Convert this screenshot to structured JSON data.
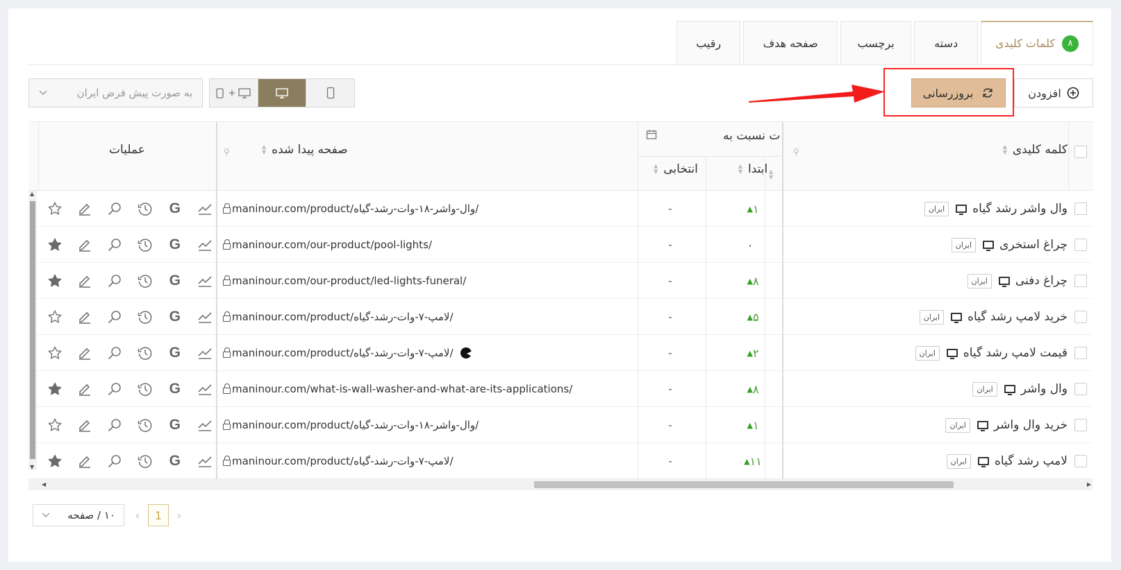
{
  "tabs": [
    {
      "label": "کلمات کلیدی",
      "badge": "۸"
    },
    {
      "label": "دسته"
    },
    {
      "label": "برچسب"
    },
    {
      "label": "صفحه هدف"
    },
    {
      "label": "رقیب"
    }
  ],
  "toolbar": {
    "add_label": "افزودن",
    "refresh_label": "بروزرسانی",
    "device_options": [
      "desktop+mobile",
      "desktop",
      "mobile"
    ],
    "selected_device": "desktop",
    "region_placeholder": "به صورت پیش فرض ایران"
  },
  "table": {
    "headers": {
      "keyword": "کلمه کلیدی",
      "change_group": "ت نسبت به",
      "first": "ابتدا",
      "chosen": "انتخابی",
      "found_page": "صفحه پیدا شده",
      "operations": "عملیات"
    },
    "rows": [
      {
        "keyword": "وال واشر رشد گیاه",
        "region": "ایران",
        "first": "۱",
        "trend": "up",
        "chosen": "-",
        "url": "maninour.com/product/وال-واشر-۱۸-وات-رشد-گیاه/",
        "starred": false,
        "special": false
      },
      {
        "keyword": "چراغ استخری",
        "region": "ایران",
        "first": "۰",
        "trend": "none",
        "chosen": "-",
        "url": "maninour.com/our-product/pool-lights/",
        "starred": true,
        "special": false
      },
      {
        "keyword": "چراغ دفنی",
        "region": "ایران",
        "first": "۸",
        "trend": "up",
        "chosen": "-",
        "url": "maninour.com/our-product/led-lights-funeral/",
        "starred": true,
        "special": false
      },
      {
        "keyword": "خرید لامپ رشد گیاه",
        "region": "ایران",
        "first": "۵",
        "trend": "up",
        "chosen": "-",
        "url": "maninour.com/product/لامپ-۷-وات-رشد-گیاه/",
        "starred": false,
        "special": false
      },
      {
        "keyword": "قیمت لامپ رشد گیاه",
        "region": "ایران",
        "first": "۲",
        "trend": "up",
        "chosen": "-",
        "url": "maninour.com/product/لامپ-۷-وات-رشد-گیاه/",
        "starred": false,
        "special": true
      },
      {
        "keyword": "وال واشر",
        "region": "ایران",
        "first": "۸",
        "trend": "up",
        "chosen": "-",
        "url": "maninour.com/what-is-wall-washer-and-what-are-its-applications/",
        "starred": true,
        "special": false
      },
      {
        "keyword": "خرید وال واشر",
        "region": "ایران",
        "first": "۱",
        "trend": "up",
        "chosen": "-",
        "url": "maninour.com/product/وال-واشر-۱۸-وات-رشد-گیاه/",
        "starred": false,
        "special": false
      },
      {
        "keyword": "لامپ رشد گیاه",
        "region": "ایران",
        "first": "۱۱",
        "trend": "up",
        "chosen": "-",
        "url": "maninour.com/product/لامپ-۷-وات-رشد-گیاه/",
        "starred": true,
        "special": false
      }
    ]
  },
  "pagination": {
    "current_page": "1",
    "page_size_label": "۱۰ / صفحه"
  }
}
